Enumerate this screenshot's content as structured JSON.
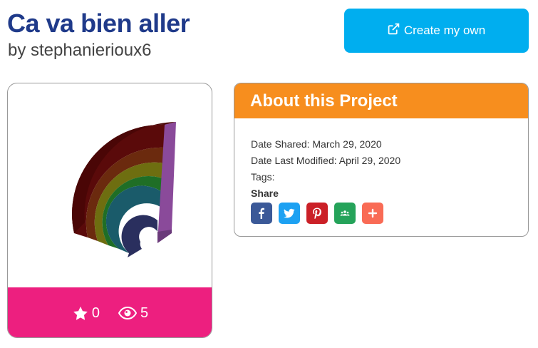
{
  "project": {
    "title": "Ca va bien aller",
    "author": "by stephanierioux6"
  },
  "create_button": {
    "label": "Create my own",
    "icon": "external-link-icon",
    "color": "#00aeef"
  },
  "card": {
    "footer_color": "#ed1f7f",
    "likes": "0",
    "views": "5",
    "like_icon": "star-icon",
    "view_icon": "eye-icon",
    "rainbow_colors": [
      "#5a0a0a",
      "#6b2a0e",
      "#6e6e10",
      "#1f6e26",
      "#1a5b6a",
      "#2a2f5e"
    ],
    "side_color": "#8a4a9a"
  },
  "about": {
    "header": "About this Project",
    "header_color": "#f78e1e",
    "date_shared": "Date Shared: March 29, 2020",
    "date_modified": "Date Last Modified: April 29, 2020",
    "tags": "Tags:",
    "share_label": "Share",
    "share_buttons": [
      {
        "name": "facebook",
        "icon": "facebook-icon",
        "color": "#3b5998"
      },
      {
        "name": "twitter",
        "icon": "twitter-icon",
        "color": "#1da1f2"
      },
      {
        "name": "pinterest",
        "icon": "pinterest-icon",
        "color": "#cb2027"
      },
      {
        "name": "google-classroom",
        "icon": "classroom-icon",
        "color": "#25a35a"
      },
      {
        "name": "more",
        "icon": "plus-icon",
        "color": "#f96b55"
      }
    ]
  }
}
